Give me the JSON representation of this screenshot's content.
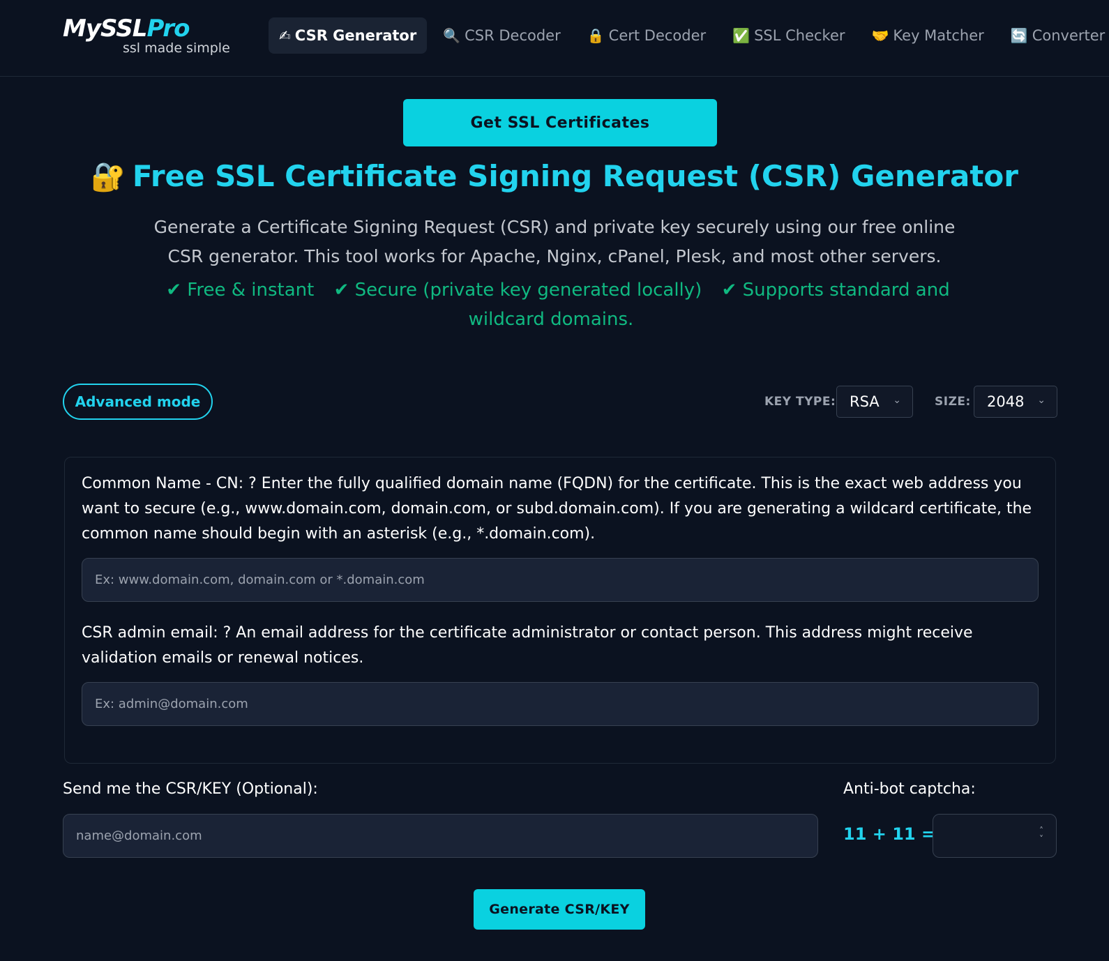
{
  "brand": {
    "name_main": "MySSL",
    "name_accent": "Pro",
    "tagline": "ssl made simple"
  },
  "nav": {
    "items": [
      {
        "icon": "✍",
        "icon_name": "writing-hand-icon",
        "label": "CSR Generator",
        "active": true
      },
      {
        "icon": "🔍",
        "icon_name": "magnifier-icon",
        "label": "CSR Decoder",
        "active": false
      },
      {
        "icon": "🔒",
        "icon_name": "lock-icon",
        "label": "Cert Decoder",
        "active": false
      },
      {
        "icon": "✅",
        "icon_name": "check-mark-icon",
        "label": "SSL Checker",
        "active": false
      },
      {
        "icon": "🤝",
        "icon_name": "handshake-icon",
        "label": "Key Matcher",
        "active": false
      },
      {
        "icon": "🔄",
        "icon_name": "refresh-icon",
        "label": "Converter",
        "active": false
      }
    ]
  },
  "hero": {
    "cta_label": "Get SSL Certificates",
    "title_icon": "🔐",
    "title": "Free SSL Certificate Signing Request (CSR) Generator",
    "subtitle": "Generate a Certificate Signing Request (CSR) and private key securely using our free online CSR generator. This tool works for Apache, Nginx, cPanel, Plesk, and most other servers.",
    "features": [
      "✔ Free & instant",
      "✔ Secure (private key generated locally)",
      "✔ Supports standard and wildcard domains."
    ]
  },
  "controls": {
    "advanced_mode_label": "Advanced mode",
    "key_type_label": "KEY TYPE:",
    "key_type_value": "RSA",
    "size_label": "SIZE:",
    "size_value": "2048"
  },
  "form": {
    "common_name": {
      "label": "Common Name - CN: ? Enter the fully qualified domain name (FQDN) for the certificate. This is the exact web address you want to secure (e.g., www.domain.com, domain.com, or subd.domain.com). If you are generating a wildcard certificate, the common name should begin with an asterisk (e.g., *.domain.com).",
      "placeholder": "Ex: www.domain.com, domain.com or *.domain.com"
    },
    "admin_email": {
      "label": "CSR admin email: ? An email address for the certificate administrator or contact person. This address might receive validation emails or renewal notices.",
      "placeholder": "Ex: admin@domain.com"
    }
  },
  "send": {
    "label": "Send me the CSR/KEY (Optional):",
    "placeholder": "name@domain.com"
  },
  "captcha": {
    "label": "Anti-bot captcha:",
    "question": "11 + 11 = ?"
  },
  "generate_label": "Generate CSR/KEY",
  "colors": {
    "background": "#0b1220",
    "accent": "#22d3ee",
    "button": "#0ad1e0",
    "feature_green": "#10b981"
  }
}
